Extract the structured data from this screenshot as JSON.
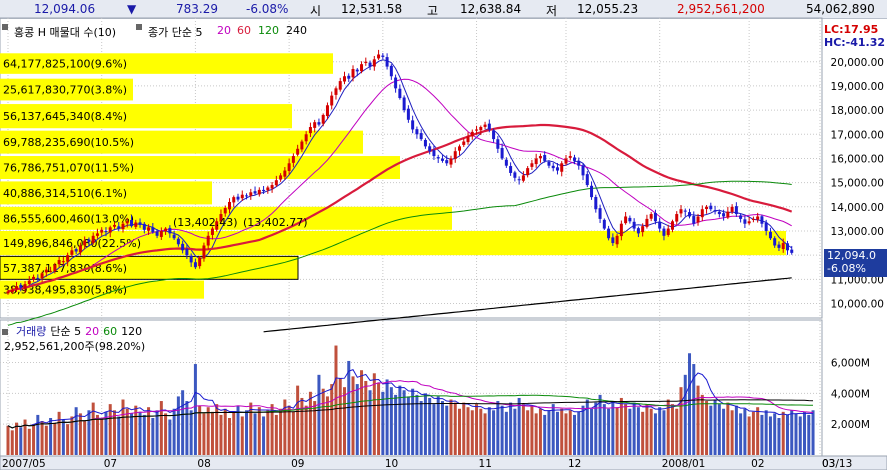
{
  "ticker": {
    "price": "12,094.06",
    "direction_symbol": "▼",
    "change": "783.29",
    "change_pct": "-6.08%",
    "open_label": "시",
    "open": "12,531.58",
    "high_label": "고",
    "high": "12,638.84",
    "low_label": "저",
    "low": "12,055.23",
    "volume": "2,952,561,200",
    "amount": "54,062,890"
  },
  "price_legend": {
    "name": "홍콩 H 매물대 수(10)",
    "ma_label": "종가 단순 5",
    "ma_periods": [
      "20",
      "60",
      "120",
      "240"
    ],
    "ma_colors": [
      "#2020c0",
      "#c000c0",
      "#d81b3c",
      "#0a8a0a",
      "#000000"
    ]
  },
  "volume_legend": {
    "name": "거래량",
    "ma_label": "단순 5",
    "ma_periods": [
      "20",
      "60",
      "120"
    ],
    "value": "2,952,561,200주(98.20%)"
  },
  "header_right": {
    "lc": "LC:17.95",
    "hc": "HC:-41.32"
  },
  "current_price_tag": {
    "price": "12,094.0",
    "pct": "-6.08%"
  },
  "chart_data": [
    {
      "type": "candlestick",
      "title": "",
      "y_ticks": [
        10000,
        11000,
        12000,
        13000,
        14000,
        15000,
        16000,
        17000,
        18000,
        19000,
        20000
      ],
      "y_tick_labels": [
        "10,000.00",
        "11,000.00",
        "12,000.00",
        "13,000.00",
        "14,000.00",
        "15,000.00",
        "16,000.00",
        "17,000.00",
        "18,000.00",
        "19,000.00",
        "20,000.00"
      ],
      "ylim": [
        9400,
        20900
      ],
      "x_labels": [
        "2007/05",
        "07",
        "08",
        "09",
        "10",
        "11",
        "12",
        "2008/01",
        "02",
        "03",
        "03/13"
      ],
      "x_label_index": [
        0,
        22,
        44,
        66,
        88,
        110,
        131,
        153,
        174,
        194,
        214
      ],
      "annotations": [
        "(13,402.43)",
        "(13,402.77)"
      ],
      "close_series": [
        10500,
        10580,
        10720,
        10650,
        10800,
        10950,
        11100,
        11050,
        11250,
        11400,
        11350,
        11600,
        11800,
        11750,
        12000,
        12200,
        12150,
        12400,
        12600,
        12550,
        12800,
        12900,
        13050,
        12950,
        13150,
        13250,
        13100,
        13300,
        13400,
        13200,
        13350,
        13250,
        13050,
        13150,
        12950,
        12800,
        13000,
        13100,
        12900,
        12700,
        12450,
        12200,
        12000,
        11700,
        11500,
        11900,
        12400,
        12800,
        13100,
        13400,
        13700,
        13950,
        14200,
        14400,
        14300,
        14500,
        14450,
        14600,
        14550,
        14700,
        14650,
        14800,
        14900,
        15100,
        15300,
        15500,
        15800,
        16100,
        16400,
        16700,
        17000,
        17300,
        17500,
        17400,
        17800,
        18200,
        18600,
        18900,
        19200,
        19400,
        19300,
        19700,
        19600,
        19900,
        20000,
        19800,
        20100,
        20300,
        20200,
        19800,
        19400,
        18900,
        18500,
        18000,
        17600,
        17200,
        17000,
        16800,
        16500,
        16300,
        16100,
        16000,
        15900,
        15800,
        16000,
        16300,
        16500,
        16700,
        16900,
        17100,
        17200,
        17300,
        17400,
        17200,
        16800,
        16400,
        16000,
        15700,
        15400,
        15200,
        15100,
        15300,
        15600,
        15800,
        16000,
        16100,
        15900,
        15700,
        15600,
        15500,
        15800,
        16000,
        16100,
        15900,
        15700,
        15300,
        14900,
        14400,
        13900,
        13500,
        13100,
        12700,
        12500,
        12800,
        13300,
        13600,
        13400,
        13100,
        12900,
        13200,
        13500,
        13700,
        13400,
        13100,
        12800,
        13100,
        13400,
        13700,
        13900,
        13800,
        13600,
        13300,
        13600,
        13900,
        14000,
        13900,
        13800,
        13700,
        13600,
        13800,
        14000,
        13700,
        13500,
        13300,
        13400,
        13500,
        13600,
        13300,
        13000,
        12700,
        12400,
        12300,
        12500,
        12200,
        12094
      ],
      "candles_per_trading_day": 1
    },
    {
      "type": "bar",
      "title": "",
      "ylabel": "",
      "y_ticks": [
        2000,
        4000,
        6000
      ],
      "y_tick_labels": [
        "2,000M",
        "4,000M",
        "6,000M"
      ],
      "ylim": [
        0,
        7200
      ],
      "volume_M": [
        1900,
        1600,
        2100,
        1800,
        2300,
        1700,
        2000,
        2600,
        2200,
        1900,
        2400,
        2100,
        2800,
        2300,
        2000,
        2500,
        3100,
        2700,
        2200,
        2900,
        3400,
        2600,
        2300,
        2800,
        3300,
        2900,
        2500,
        3600,
        3000,
        2700,
        3200,
        2800,
        2600,
        3100,
        2400,
        2900,
        3500,
        2700,
        2300,
        3000,
        3800,
        4200,
        3500,
        2900,
        5900,
        3200,
        2700,
        3100,
        2800,
        3300,
        2600,
        3000,
        2400,
        2800,
        3200,
        2500,
        2900,
        3400,
        2700,
        3100,
        2500,
        2900,
        3300,
        2600,
        3000,
        3600,
        3200,
        2800,
        4500,
        3700,
        3200,
        4100,
        3500,
        5200,
        4300,
        3800,
        4600,
        7100,
        5000,
        4400,
        6100,
        5100,
        4600,
        5500,
        4800,
        4200,
        5300,
        4700,
        4100,
        4900,
        4400,
        3900,
        4500,
        4200,
        3800,
        4300,
        3900,
        3500,
        4000,
        3700,
        3300,
        3800,
        3500,
        3200,
        3600,
        3400,
        3000,
        3400,
        3100,
        2900,
        3300,
        3000,
        2700,
        3100,
        2900,
        3500,
        3200,
        2800,
        3400,
        3000,
        3700,
        3300,
        2900,
        3200,
        2700,
        3000,
        2600,
        2900,
        3300,
        2800,
        3000,
        2700,
        2900,
        2600,
        2800,
        3200,
        3600,
        3000,
        3400,
        3900,
        3300,
        3000,
        3500,
        3100,
        3700,
        3300,
        3000,
        3400,
        3100,
        2800,
        3300,
        3000,
        2700,
        3100,
        2900,
        3600,
        3300,
        3000,
        4400,
        5200,
        6600,
        5900,
        4500,
        3900,
        3500,
        3200,
        3600,
        3300,
        3000,
        3400,
        2900,
        3200,
        2700,
        3000,
        2500,
        2800,
        3100,
        2600,
        2900,
        2500,
        2700,
        2400,
        2800,
        2600,
        2900,
        2700,
        2500,
        2800,
        2600,
        2900
      ]
    }
  ]
}
